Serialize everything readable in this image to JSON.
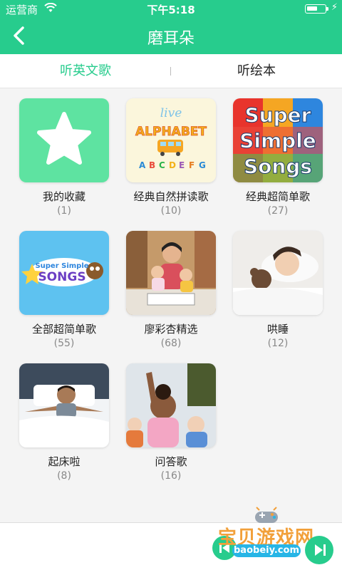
{
  "status_bar": {
    "carrier": "运营商",
    "time": "下午5:18"
  },
  "nav": {
    "title": "磨耳朵"
  },
  "tabs": [
    {
      "label": "听英文歌",
      "active": true
    },
    {
      "label": "听绘本",
      "active": false
    }
  ],
  "albums": [
    {
      "title": "我的收藏",
      "count": "(1)",
      "art": "star-icon"
    },
    {
      "title": "经典自然拼读歌",
      "count": "(10)",
      "art": "live-alphabet-cover",
      "art_texts": [
        "live",
        "ALPHABET",
        "A",
        "B",
        "C",
        "D",
        "E",
        "F",
        "G"
      ]
    },
    {
      "title": "经典超简单歌",
      "count": "(27)",
      "art": "super-simple-songs-cover",
      "art_texts": [
        "Super",
        "Simple",
        "Songs"
      ]
    },
    {
      "title": "全部超简单歌",
      "count": "(55)",
      "art": "super-simple-songs-banner",
      "art_texts": [
        "Super Simple",
        "SONGS"
      ]
    },
    {
      "title": "廖彩杏精选",
      "count": "(68)",
      "art": "photo-teacher-with-kids"
    },
    {
      "title": "哄睡",
      "count": "(12)",
      "art": "photo-sleeping-girl"
    },
    {
      "title": "起床啦",
      "count": "(8)",
      "art": "photo-boy-waking-up"
    },
    {
      "title": "问答歌",
      "count": "(16)",
      "art": "photo-girl-raising-hand"
    }
  ],
  "watermark": {
    "text": "宝贝游戏网",
    "url": "baobeiy.com"
  },
  "colors": {
    "brand": "#27cc8d",
    "star_tile": "#5ee3a1",
    "text": "#222222",
    "muted": "#888888"
  }
}
